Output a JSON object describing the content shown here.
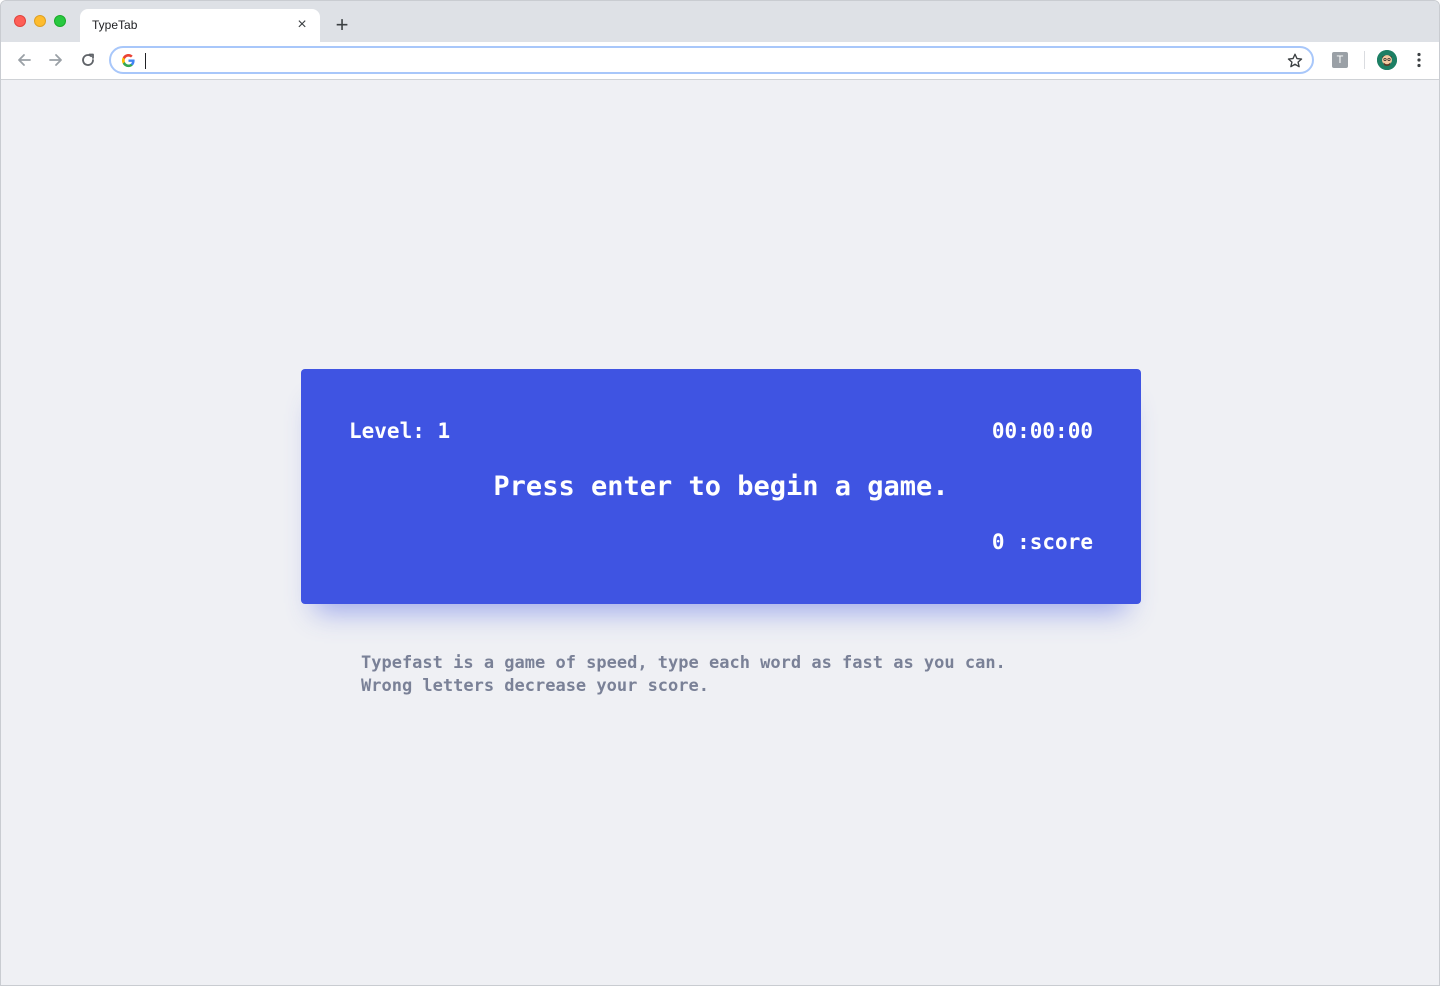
{
  "browser": {
    "tab_title": "TypeTab",
    "tab_close_glyph": "×",
    "new_tab_glyph": "+",
    "omnibox_value": "",
    "extension_label": "T",
    "icons": {
      "back": "arrow-left-icon",
      "forward": "arrow-right-icon",
      "reload": "reload-icon",
      "search_engine": "google-g-icon",
      "bookmark": "star-icon",
      "menu": "kebab-menu-icon"
    }
  },
  "game": {
    "level_label": "Level: 1",
    "timer": "00:00:00",
    "prompt": "Press enter to begin a game.",
    "score_label": "0 :score",
    "card_color": "#3f54e2"
  },
  "description": {
    "line1": "Typefast is a game of speed, type each word as fast as you can.",
    "line2": "Wrong letters decrease your score."
  }
}
